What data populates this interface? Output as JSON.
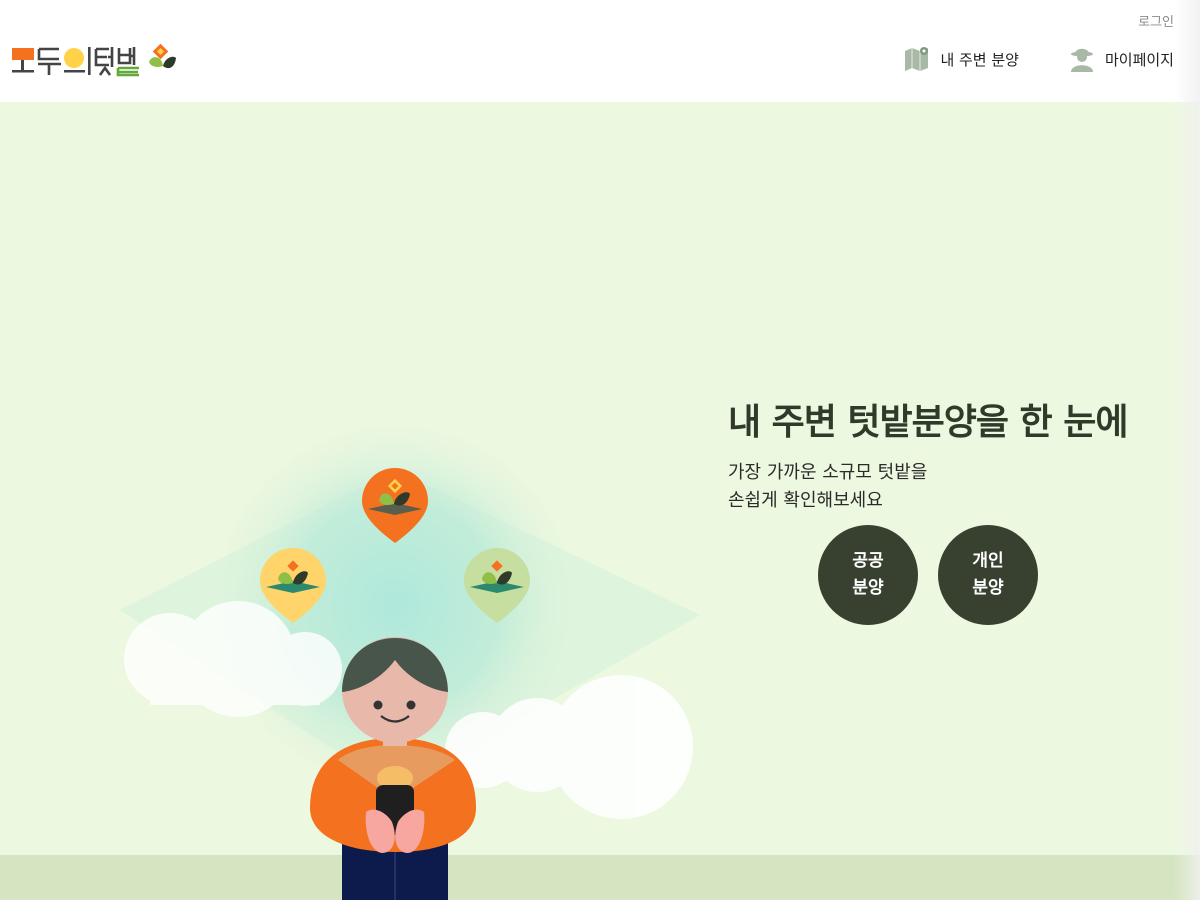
{
  "header": {
    "login_label": "로그인",
    "logo_text": "모두의텃밭",
    "nav": [
      {
        "label": "내 주변 분양",
        "icon": "map-pin-icon"
      },
      {
        "label": "마이페이지",
        "icon": "farmer-user-icon"
      }
    ]
  },
  "hero": {
    "title": "내 주변 텃밭분양을 한 눈에",
    "subtitle_lines": [
      "가장 가까운 소규모 텃밭을",
      "손쉽게 확인해보세요"
    ],
    "buttons": [
      {
        "line1": "공공",
        "line2": "분양"
      },
      {
        "line1": "개인",
        "line2": "분양"
      }
    ]
  },
  "colors": {
    "brand_orange": "#f4711f",
    "brand_yellow": "#ffd24a",
    "dark_green": "#384130",
    "hero_background": "#edf8e0",
    "ground": "#d6e5c1"
  }
}
